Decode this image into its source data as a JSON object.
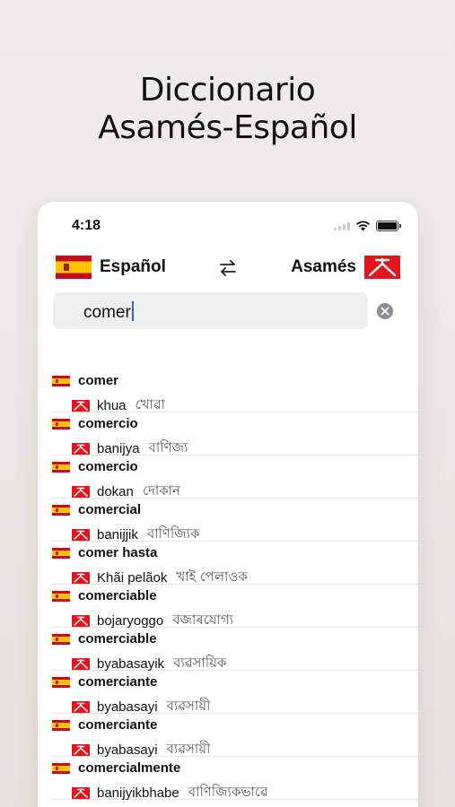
{
  "promo": {
    "line1": "Diccionario",
    "line2": "Asamés-Español"
  },
  "status": {
    "time": "4:18"
  },
  "languages": {
    "source": "Español",
    "target": "Asamés"
  },
  "search": {
    "value": "comer"
  },
  "results": [
    {
      "word": "comer",
      "translit": "khua",
      "native": "খোৱা"
    },
    {
      "word": "comercio",
      "translit": "banijya",
      "native": "বাণিজ্য"
    },
    {
      "word": "comercio",
      "translit": "dokan",
      "native": "দোকান"
    },
    {
      "word": "comercial",
      "translit": "banijjik",
      "native": "বাণিজ্যিক"
    },
    {
      "word": "comer hasta",
      "translit": "Khãi pelãok",
      "native": "খাই পেলাওক"
    },
    {
      "word": "comerciable",
      "translit": "bojaryoggo",
      "native": "বজাৰযোগ্য"
    },
    {
      "word": "comerciable",
      "translit": "byabasayik",
      "native": "ব্যৱসায়িক"
    },
    {
      "word": "comerciante",
      "translit": "byabasayi",
      "native": "ব্যৱসায়ী"
    },
    {
      "word": "comerciante",
      "translit": "byabasayi",
      "native": "ব্যৱসায়ী"
    },
    {
      "word": "comercialmente",
      "translit": "banijyikbhabe",
      "native": "বাণিজ্যিকভাৱে"
    }
  ],
  "colors": {
    "spain_red": "#c60b1e",
    "spain_yellow": "#ffc400",
    "assam_red": "#e3141b",
    "caret": "#2b66d8"
  }
}
